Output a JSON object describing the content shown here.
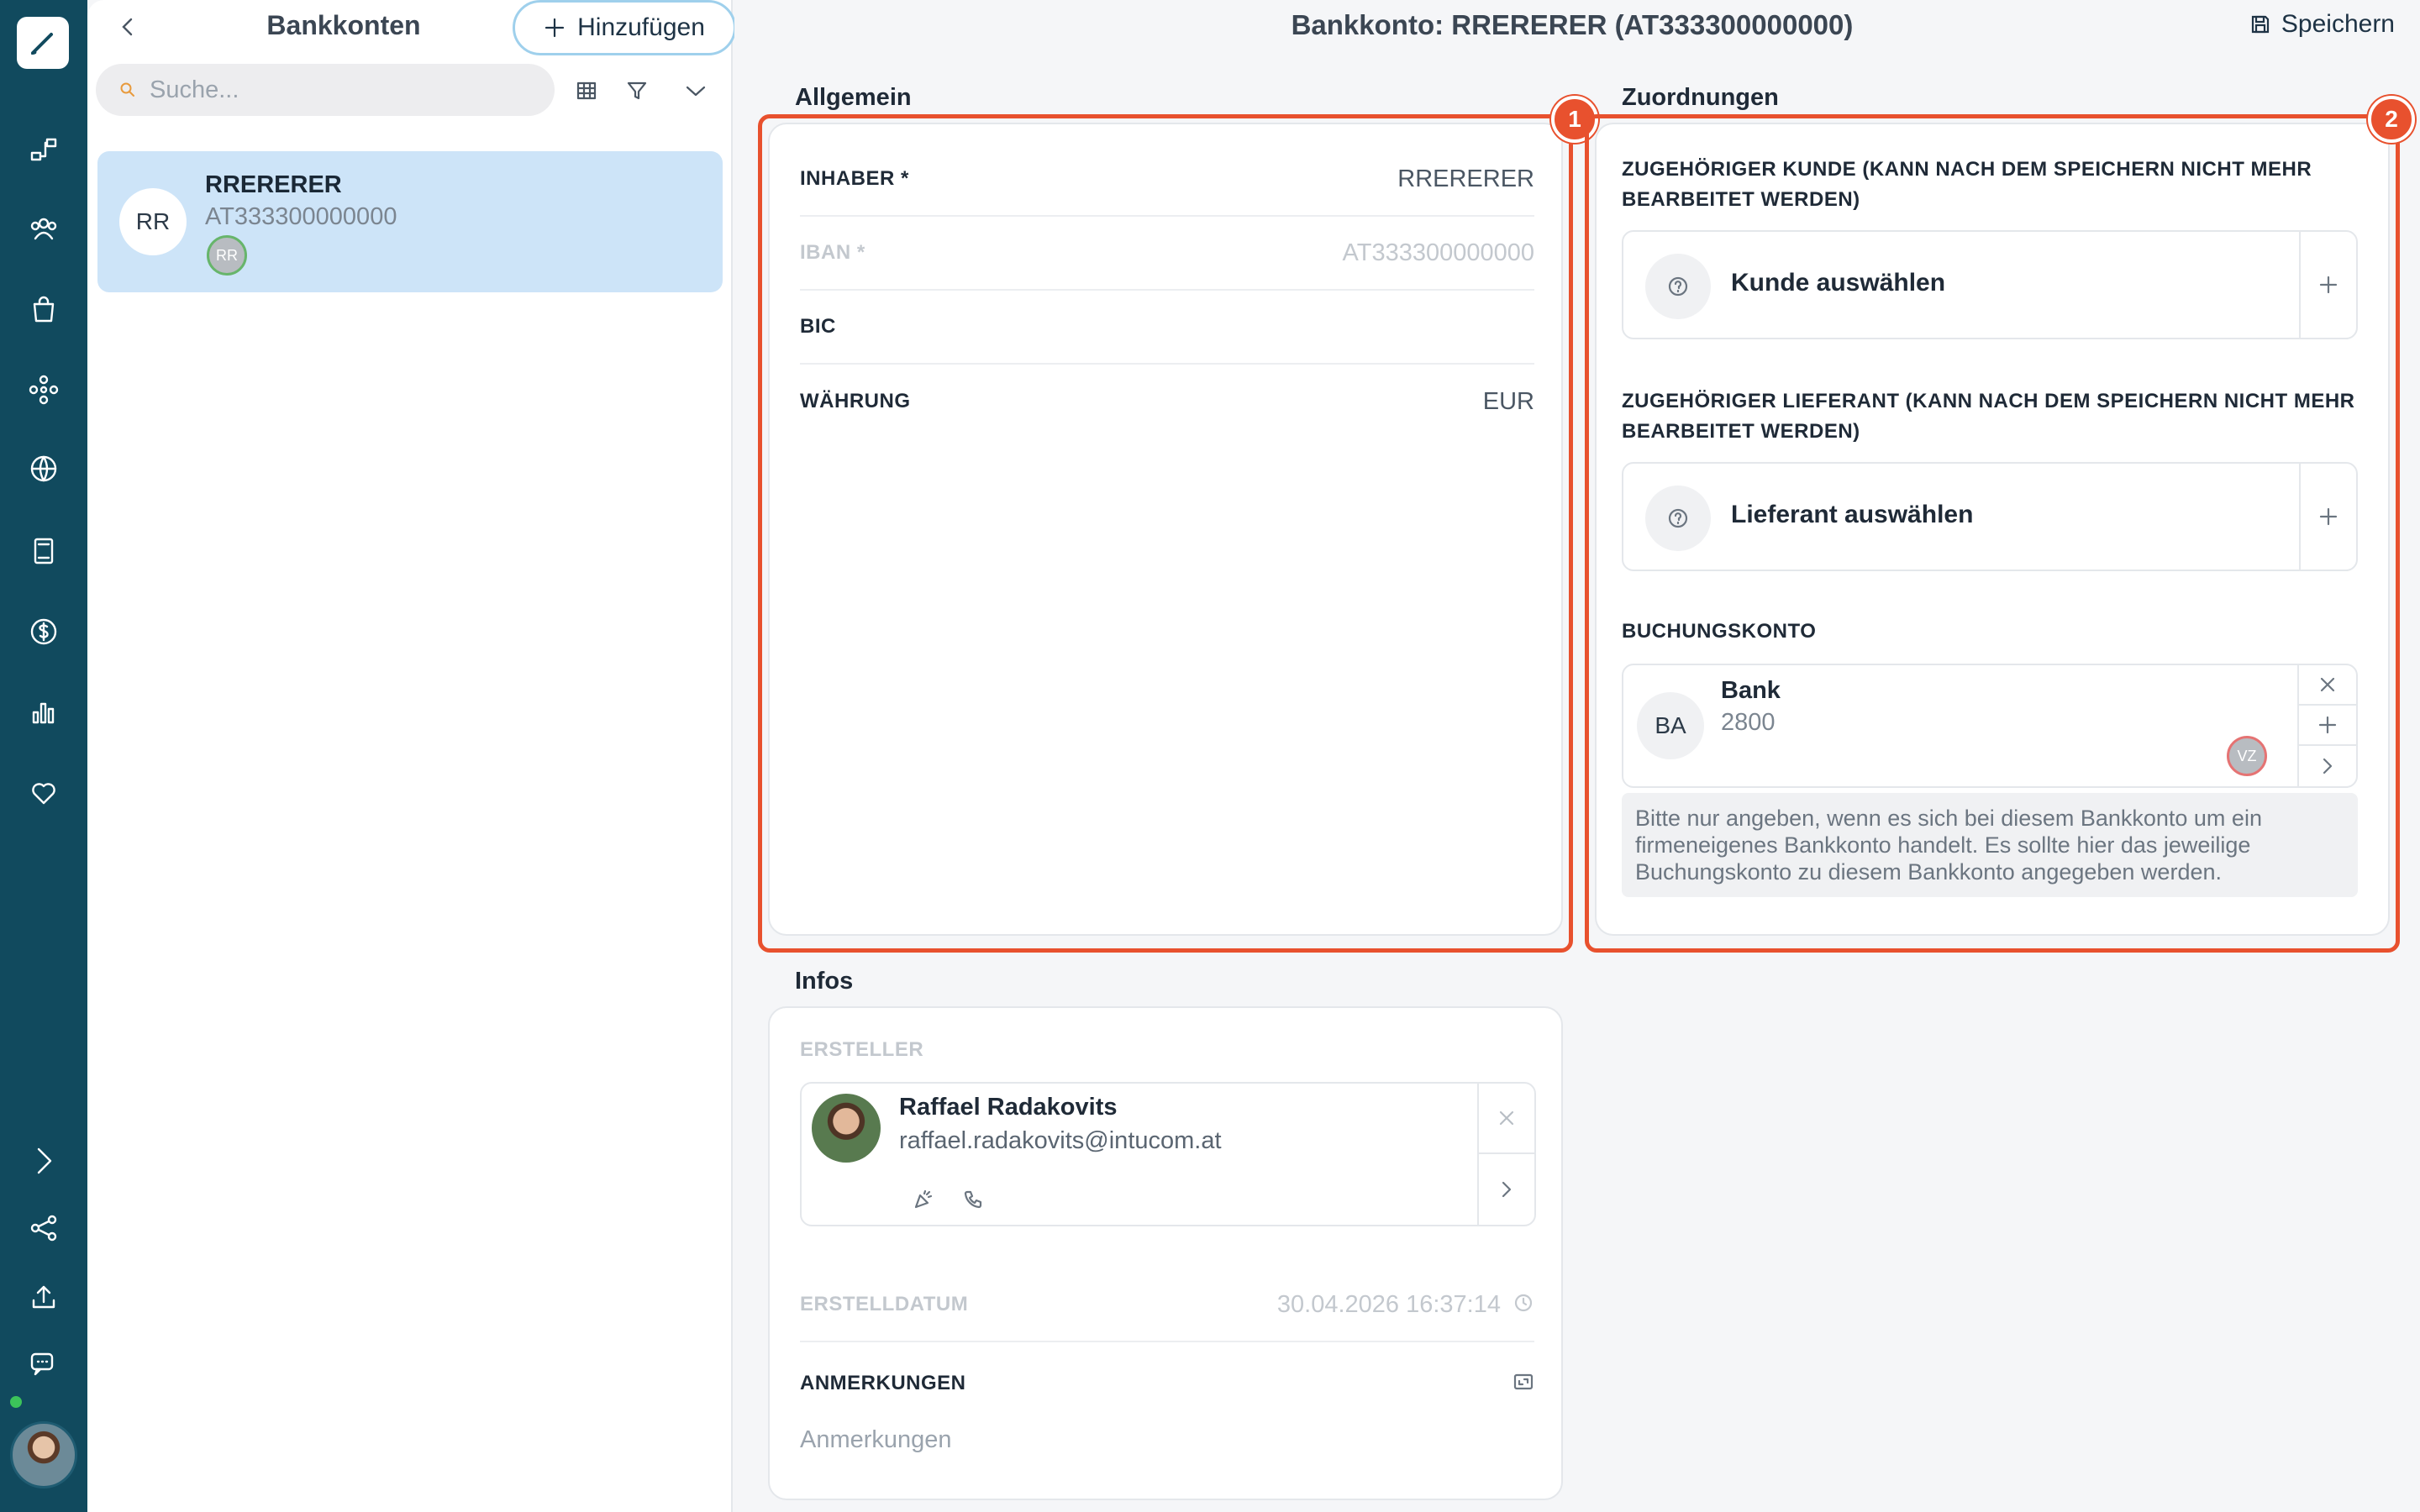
{
  "nav": {
    "items": [
      "brush-logo-icon",
      "workflow-icon",
      "users-icon",
      "shopping-bag-icon",
      "network-icon",
      "globe-icon",
      "book-icon",
      "dollar-icon",
      "bar-chart-icon",
      "heart-icon",
      "chevron-right-icon",
      "share-icon",
      "upload-icon",
      "chat-icon"
    ]
  },
  "list": {
    "title": "Bankkonten",
    "add_label": "Hinzufügen",
    "search_placeholder": "Suche...",
    "items": [
      {
        "initials": "RR",
        "name": "RRERERER",
        "iban": "AT333300000000",
        "badge": "RR"
      }
    ]
  },
  "header": {
    "title": "Bankkonto: RRERERER (AT333300000000)",
    "save_label": "Speichern"
  },
  "general": {
    "title": "Allgemein",
    "marker": "1",
    "fields": [
      {
        "label": "INHABER *",
        "value": "RRERERER"
      },
      {
        "label": "IBAN *",
        "value": "AT333300000000"
      },
      {
        "label": "BIC",
        "value": ""
      },
      {
        "label": "WÄHRUNG",
        "value": "EUR"
      }
    ]
  },
  "assign": {
    "title": "Zuordnungen",
    "marker": "2",
    "customer_caption": "ZUGEHÖRIGER KUNDE (KANN NACH DEM SPEICHERN NICHT MEHR BEARBEITET WERDEN)",
    "customer_select": "Kunde auswählen",
    "supplier_caption": "ZUGEHÖRIGER LIEFERANT (KANN NACH DEM SPEICHERN NICHT MEHR BEARBEITET WERDEN)",
    "supplier_select": "Lieferant auswählen",
    "account_caption": "BUCHUNGSKONTO",
    "account": {
      "initials": "BA",
      "name": "Bank",
      "number": "2800",
      "badge": "VZ"
    },
    "hint": "Bitte nur angeben, wenn es sich bei diesem Bankkonto um ein firmeneigenes Bankkonto handelt. Es sollte hier das jeweilige Buchungskonto zu diesem Bankkonto angegeben werden."
  },
  "infos": {
    "title": "Infos",
    "creator_label": "ERSTELLER",
    "creator_name": "Raffael Radakovits",
    "creator_email": "raffael.radakovits@intucom.at",
    "created_label": "ERSTELLDATUM",
    "created_value": "30.04.2026 16:37:14",
    "notes_label": "ANMERKUNGEN",
    "notes_placeholder": "Anmerkungen"
  },
  "colors": {
    "rail": "#114a5e",
    "accent": "#e8512e",
    "selected": "#cde4f8"
  }
}
